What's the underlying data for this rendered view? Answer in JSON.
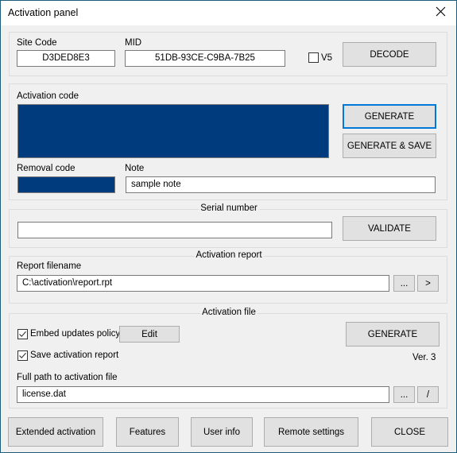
{
  "window": {
    "title": "Activation panel",
    "close_icon": "close-x-icon"
  },
  "decode_section": {
    "site_code_label": "Site Code",
    "site_code_value": "D3DED8E3",
    "mid_label": "MID",
    "mid_value": "51DB-93CE-C9BA-7B25",
    "v5_label": "V5",
    "v5_checked": false,
    "decode_button": "DECODE"
  },
  "activation_section": {
    "activation_code_label": "Activation code",
    "activation_code_value": "",
    "generate_button": "GENERATE",
    "generate_save_button": "GENERATE & SAVE",
    "removal_code_label": "Removal code",
    "removal_code_value": "",
    "note_label": "Note",
    "note_value": "sample note",
    "highlight_color": "#003c7d"
  },
  "serial_section": {
    "legend": "Serial number",
    "serial_value": "",
    "validate_button": "VALIDATE"
  },
  "report_section": {
    "legend": "Activation report",
    "report_filename_label": "Report filename",
    "report_filename_value": "C:\\activation\\report.rpt",
    "browse_button": "...",
    "open_button": ">"
  },
  "file_section": {
    "legend": "Activation file",
    "embed_updates_label": "Embed updates policy",
    "embed_updates_checked": true,
    "edit_button": "Edit",
    "save_report_label": "Save activation report",
    "save_report_checked": true,
    "generate_button": "GENERATE",
    "version_text": "Ver. 3",
    "full_path_label": "Full path to activation file",
    "full_path_value": "license.dat",
    "browse_button": "...",
    "slash_button": "/"
  },
  "footer": {
    "extended_activation_button": "Extended activation",
    "features_button": "Features",
    "user_info_button": "User info",
    "remote_settings_button": "Remote settings",
    "close_button": "CLOSE"
  }
}
